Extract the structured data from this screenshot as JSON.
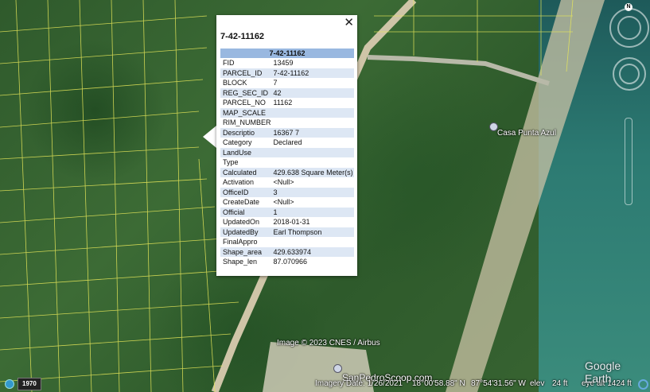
{
  "popup": {
    "close_glyph": "✕",
    "title": "7-42-11162",
    "table_header": "7-42-11162",
    "rows": [
      {
        "key": "FID",
        "value": "13459"
      },
      {
        "key": "PARCEL_ID",
        "value": "7-42-11162"
      },
      {
        "key": "BLOCK",
        "value": "7"
      },
      {
        "key": "REG_SEC_ID",
        "value": "42"
      },
      {
        "key": "PARCEL_NO",
        "value": "11162"
      },
      {
        "key": "MAP_SCALE",
        "value": ""
      },
      {
        "key": "RIM_NUMBER",
        "value": ""
      },
      {
        "key": "Descriptio",
        "value": "16367 7"
      },
      {
        "key": "Category",
        "value": "Declared"
      },
      {
        "key": "LandUse",
        "value": ""
      },
      {
        "key": "Type",
        "value": ""
      },
      {
        "key": "Calculated",
        "value": "429.638 Square Meter(s)"
      },
      {
        "key": "Activation",
        "value": "<Null>"
      },
      {
        "key": "OfficeID",
        "value": "3"
      },
      {
        "key": "CreateDate",
        "value": "<Null>"
      },
      {
        "key": "Official",
        "value": "1"
      },
      {
        "key": "UpdatedOn",
        "value": "2018-01-31"
      },
      {
        "key": "UpdatedBy",
        "value": "Earl Thompson"
      },
      {
        "key": "FinalAppro",
        "value": ""
      },
      {
        "key": "Shape_area",
        "value": "429.633974"
      },
      {
        "key": "Shape_len",
        "value": "87.070966"
      }
    ]
  },
  "map": {
    "place_labels": {
      "casa": "Casa Punta Azul",
      "scoop": "SanPedroScoop.com"
    },
    "image_credit": "Image © 2023 CNES / Airbus"
  },
  "status": {
    "year": "1970",
    "imagery_date": "Imagery Date: 1/26/2021",
    "lat": "18°00'58.88\" N",
    "lon": "87°54'31.56\" W",
    "elev_label": "elev",
    "elev_value": "24 ft",
    "eye_alt": "eye alt  1424 ft"
  },
  "brand": {
    "logo": "Google Earth"
  },
  "nav": {
    "north_label": "N"
  },
  "colors": {
    "parcel_lines": "#e8e85a",
    "table_header": "#99b8e0",
    "alt_row": "#dde7f4"
  }
}
